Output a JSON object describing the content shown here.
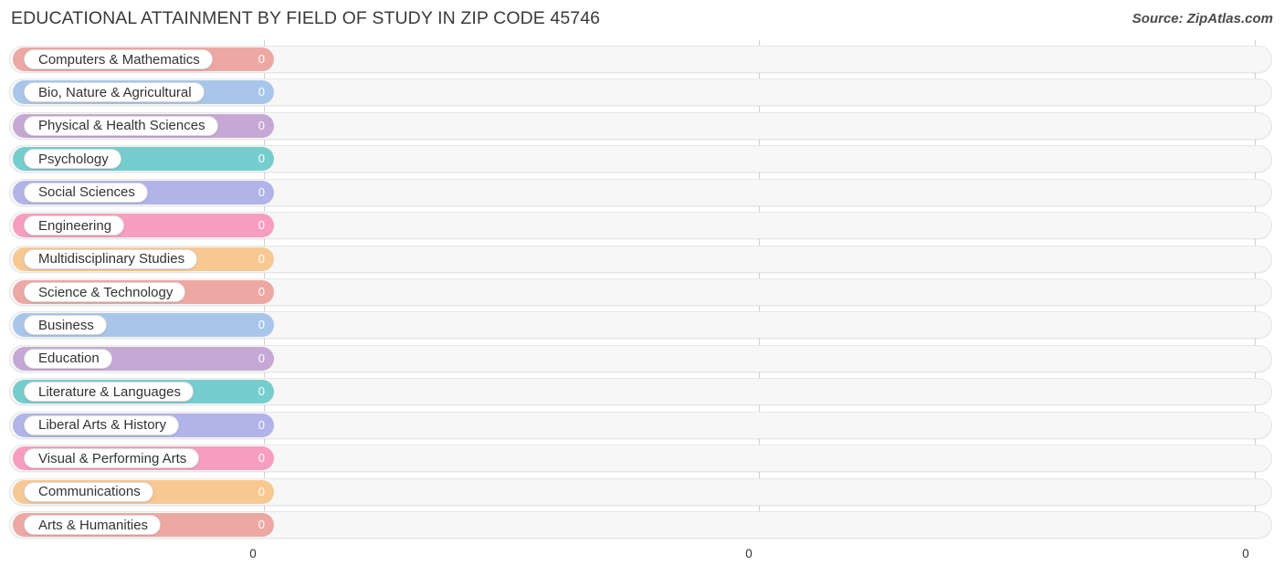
{
  "header": {
    "title": "EDUCATIONAL ATTAINMENT BY FIELD OF STUDY IN ZIP CODE 45746",
    "source": "Source: ZipAtlas.com"
  },
  "chart_data": {
    "type": "bar",
    "orientation": "horizontal",
    "title": "EDUCATIONAL ATTAINMENT BY FIELD OF STUDY IN ZIP CODE 45746",
    "subtitle": "Source: ZipAtlas.com",
    "xlabel": "",
    "ylabel": "",
    "xlim": [
      0,
      0
    ],
    "grid": true,
    "legend": false,
    "xticks": [
      "0",
      "0",
      "0"
    ],
    "categories": [
      "Computers & Mathematics",
      "Bio, Nature & Agricultural",
      "Physical & Health Sciences",
      "Psychology",
      "Social Sciences",
      "Engineering",
      "Multidisciplinary Studies",
      "Science & Technology",
      "Business",
      "Education",
      "Literature & Languages",
      "Liberal Arts & History",
      "Visual & Performing Arts",
      "Communications",
      "Arts & Humanities"
    ],
    "values": [
      0,
      0,
      0,
      0,
      0,
      0,
      0,
      0,
      0,
      0,
      0,
      0,
      0,
      0,
      0
    ],
    "value_labels": [
      "0",
      "0",
      "0",
      "0",
      "0",
      "0",
      "0",
      "0",
      "0",
      "0",
      "0",
      "0",
      "0",
      "0",
      "0"
    ],
    "colors": [
      "#eda8a4",
      "#a8c6ea",
      "#c6a8d4",
      "#76cdcd",
      "#b0b4e8",
      "#f79ec0",
      "#f8c893",
      "#eda8a4",
      "#a8c6ea",
      "#c6a8d4",
      "#76cdcd",
      "#b0b4e8",
      "#f79ec0",
      "#f8c893",
      "#eda8a4"
    ]
  },
  "rows": [
    {
      "label": "Computers & Mathematics",
      "value": "0",
      "color": "#eda8a4"
    },
    {
      "label": "Bio, Nature & Agricultural",
      "value": "0",
      "color": "#a8c6ea"
    },
    {
      "label": "Physical & Health Sciences",
      "value": "0",
      "color": "#c6a8d4"
    },
    {
      "label": "Psychology",
      "value": "0",
      "color": "#76cdcd"
    },
    {
      "label": "Social Sciences",
      "value": "0",
      "color": "#b0b4e8"
    },
    {
      "label": "Engineering",
      "value": "0",
      "color": "#f79ec0"
    },
    {
      "label": "Multidisciplinary Studies",
      "value": "0",
      "color": "#f8c893"
    },
    {
      "label": "Science & Technology",
      "value": "0",
      "color": "#eda8a4"
    },
    {
      "label": "Business",
      "value": "0",
      "color": "#a8c6ea"
    },
    {
      "label": "Education",
      "value": "0",
      "color": "#c6a8d4"
    },
    {
      "label": "Literature & Languages",
      "value": "0",
      "color": "#76cdcd"
    },
    {
      "label": "Liberal Arts & History",
      "value": "0",
      "color": "#b0b4e8"
    },
    {
      "label": "Visual & Performing Arts",
      "value": "0",
      "color": "#f79ec0"
    },
    {
      "label": "Communications",
      "value": "0",
      "color": "#f8c893"
    },
    {
      "label": "Arts & Humanities",
      "value": "0",
      "color": "#eda8a4"
    }
  ],
  "axis": {
    "ticks": [
      {
        "label": "0",
        "x": 277
      },
      {
        "label": "0",
        "x": 820
      },
      {
        "label": "0",
        "x": 1364
      }
    ]
  },
  "gridlines": [
    289,
    831,
    1374
  ]
}
